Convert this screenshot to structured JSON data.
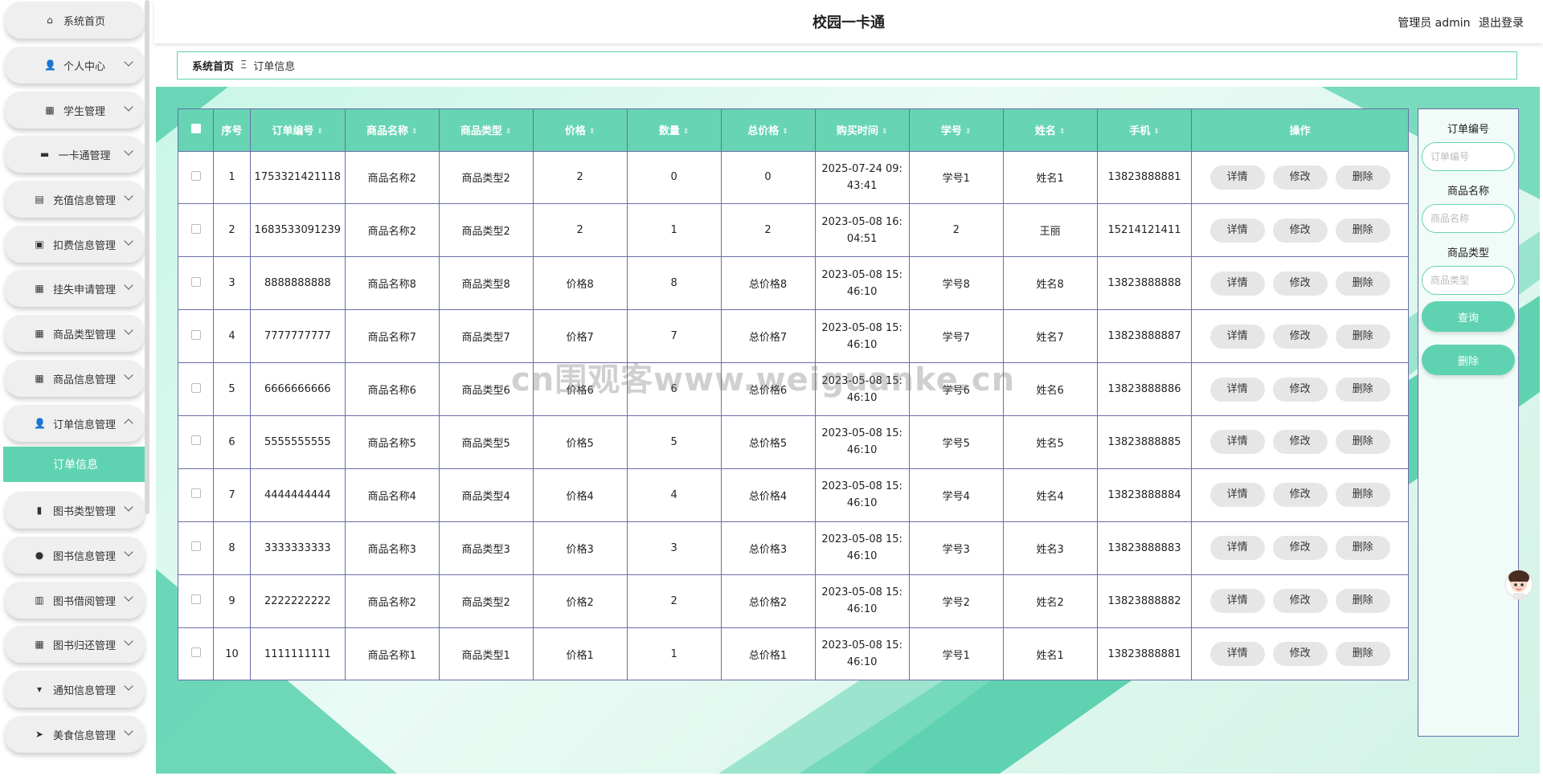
{
  "app": {
    "title": "校园一卡通"
  },
  "user": {
    "role_name": "管理员 admin",
    "logout": "退出登录"
  },
  "sidebar": {
    "items": [
      {
        "label": "系统首页",
        "icon": "home-icon",
        "glyph": "⌂"
      },
      {
        "label": "个人中心",
        "icon": "user-icon",
        "glyph": "👤"
      },
      {
        "label": "学生管理",
        "icon": "grid-icon",
        "glyph": "▦"
      },
      {
        "label": "一卡通管理",
        "icon": "monitor-icon",
        "glyph": "▬"
      },
      {
        "label": "充值信息管理",
        "icon": "clipboard-icon",
        "glyph": "▤"
      },
      {
        "label": "扣费信息管理",
        "icon": "clipboard-check-icon",
        "glyph": "▣"
      },
      {
        "label": "挂失申请管理",
        "icon": "grid-icon",
        "glyph": "▦"
      },
      {
        "label": "商品类型管理",
        "icon": "grid-icon",
        "glyph": "▦"
      },
      {
        "label": "商品信息管理",
        "icon": "grid-icon",
        "glyph": "▦"
      },
      {
        "label": "订单信息管理",
        "icon": "user-icon",
        "glyph": "👤"
      },
      {
        "label": "图书类型管理",
        "icon": "bar-chart-icon",
        "glyph": "▮"
      },
      {
        "label": "图书信息管理",
        "icon": "pin-icon",
        "glyph": "●"
      },
      {
        "label": "图书借阅管理",
        "icon": "book-icon",
        "glyph": "▥"
      },
      {
        "label": "图书归还管理",
        "icon": "grid-icon",
        "glyph": "▦"
      },
      {
        "label": "通知信息管理",
        "icon": "trophy-icon",
        "glyph": "▾"
      },
      {
        "label": "美食信息管理",
        "icon": "send-icon",
        "glyph": "➤"
      }
    ],
    "active_sub": "订单信息"
  },
  "breadcrumb": {
    "home": "系统首页",
    "sep": "Ξ",
    "current": "订单信息"
  },
  "table": {
    "headers": [
      "序号",
      "订单编号",
      "商品名称",
      "商品类型",
      "价格",
      "数量",
      "总价格",
      "购买时间",
      "学号",
      "姓名",
      "手机",
      "操作"
    ],
    "rows": [
      [
        "1",
        "1753321421118",
        "商品名称2",
        "商品类型2",
        "2",
        "0",
        "0",
        "2025-07-24 09:",
        "43:41",
        "学号1",
        "姓名1",
        "13823888881"
      ],
      [
        "2",
        "1683533091239",
        "商品名称2",
        "商品类型2",
        "2",
        "1",
        "2",
        "2023-05-08 16:",
        "04:51",
        "2",
        "王丽",
        "15214121411"
      ],
      [
        "3",
        "8888888888",
        "商品名称8",
        "商品类型8",
        "价格8",
        "8",
        "总价格8",
        "2023-05-08 15:",
        "46:10",
        "学号8",
        "姓名8",
        "13823888888"
      ],
      [
        "4",
        "7777777777",
        "商品名称7",
        "商品类型7",
        "价格7",
        "7",
        "总价格7",
        "2023-05-08 15:",
        "46:10",
        "学号7",
        "姓名7",
        "13823888887"
      ],
      [
        "5",
        "6666666666",
        "商品名称6",
        "商品类型6",
        "价格6",
        "6",
        "总价格6",
        "2023-05-08 15:",
        "46:10",
        "学号6",
        "姓名6",
        "13823888886"
      ],
      [
        "6",
        "5555555555",
        "商品名称5",
        "商品类型5",
        "价格5",
        "5",
        "总价格5",
        "2023-05-08 15:",
        "46:10",
        "学号5",
        "姓名5",
        "13823888885"
      ],
      [
        "7",
        "4444444444",
        "商品名称4",
        "商品类型4",
        "价格4",
        "4",
        "总价格4",
        "2023-05-08 15:",
        "46:10",
        "学号4",
        "姓名4",
        "13823888884"
      ],
      [
        "8",
        "3333333333",
        "商品名称3",
        "商品类型3",
        "价格3",
        "3",
        "总价格3",
        "2023-05-08 15:",
        "46:10",
        "学号3",
        "姓名3",
        "13823888883"
      ],
      [
        "9",
        "2222222222",
        "商品名称2",
        "商品类型2",
        "价格2",
        "2",
        "总价格2",
        "2023-05-08 15:",
        "46:10",
        "学号2",
        "姓名2",
        "13823888882"
      ],
      [
        "10",
        "1111111111",
        "商品名称1",
        "商品类型1",
        "价格1",
        "1",
        "总价格1",
        "2023-05-08 15:",
        "46:10",
        "学号1",
        "姓名1",
        "13823888881"
      ]
    ],
    "actions": {
      "detail": "详情",
      "edit": "修改",
      "delete": "删除"
    }
  },
  "search": {
    "order_no_label": "订单编号",
    "order_no_placeholder": "订单编号",
    "product_name_label": "商品名称",
    "product_name_placeholder": "商品名称",
    "product_type_label": "商品类型",
    "product_type_placeholder": "商品类型",
    "query_button": "查询",
    "delete_button": "删除"
  },
  "watermark": "cn围观客www.weiguanke.cn",
  "colors": {
    "accent": "#5fd3b1",
    "header_bg": "#67d4b3",
    "border": "#6a6fa7"
  }
}
